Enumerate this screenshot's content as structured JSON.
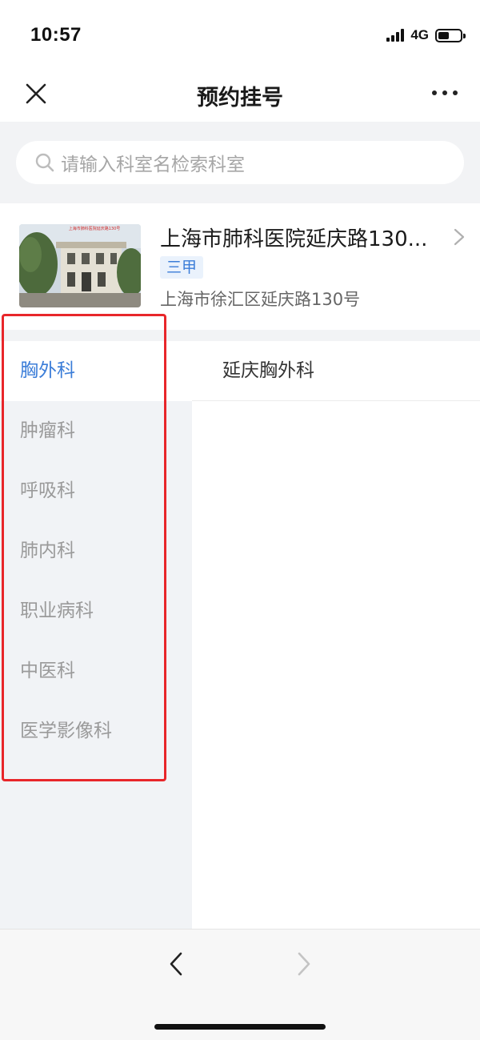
{
  "status_bar": {
    "time": "10:57",
    "network": "4G"
  },
  "nav": {
    "title": "预约挂号"
  },
  "search": {
    "placeholder": "请输入科室名检索科室"
  },
  "hospital": {
    "name": "上海市肺科医院延庆路130...",
    "grade": "三甲",
    "address": "上海市徐汇区延庆路130号",
    "image_caption": "上海市肺科医院延庆路130号"
  },
  "departments": [
    {
      "label": "胸外科",
      "active": true
    },
    {
      "label": "肿瘤科",
      "active": false
    },
    {
      "label": "呼吸科",
      "active": false
    },
    {
      "label": "肺内科",
      "active": false
    },
    {
      "label": "职业病科",
      "active": false
    },
    {
      "label": "中医科",
      "active": false
    },
    {
      "label": "医学影像科",
      "active": false
    }
  ],
  "sub_departments": [
    {
      "label": "延庆胸外科"
    }
  ],
  "colors": {
    "accent": "#3b7dd8",
    "highlight_border": "#e8262a",
    "sidebar_bg": "#f1f3f6",
    "inactive_text": "#9a9a9a"
  },
  "icons": [
    "close-icon",
    "more-icon",
    "search-icon",
    "chevron-right-icon",
    "back-arrow-icon",
    "forward-arrow-icon"
  ]
}
